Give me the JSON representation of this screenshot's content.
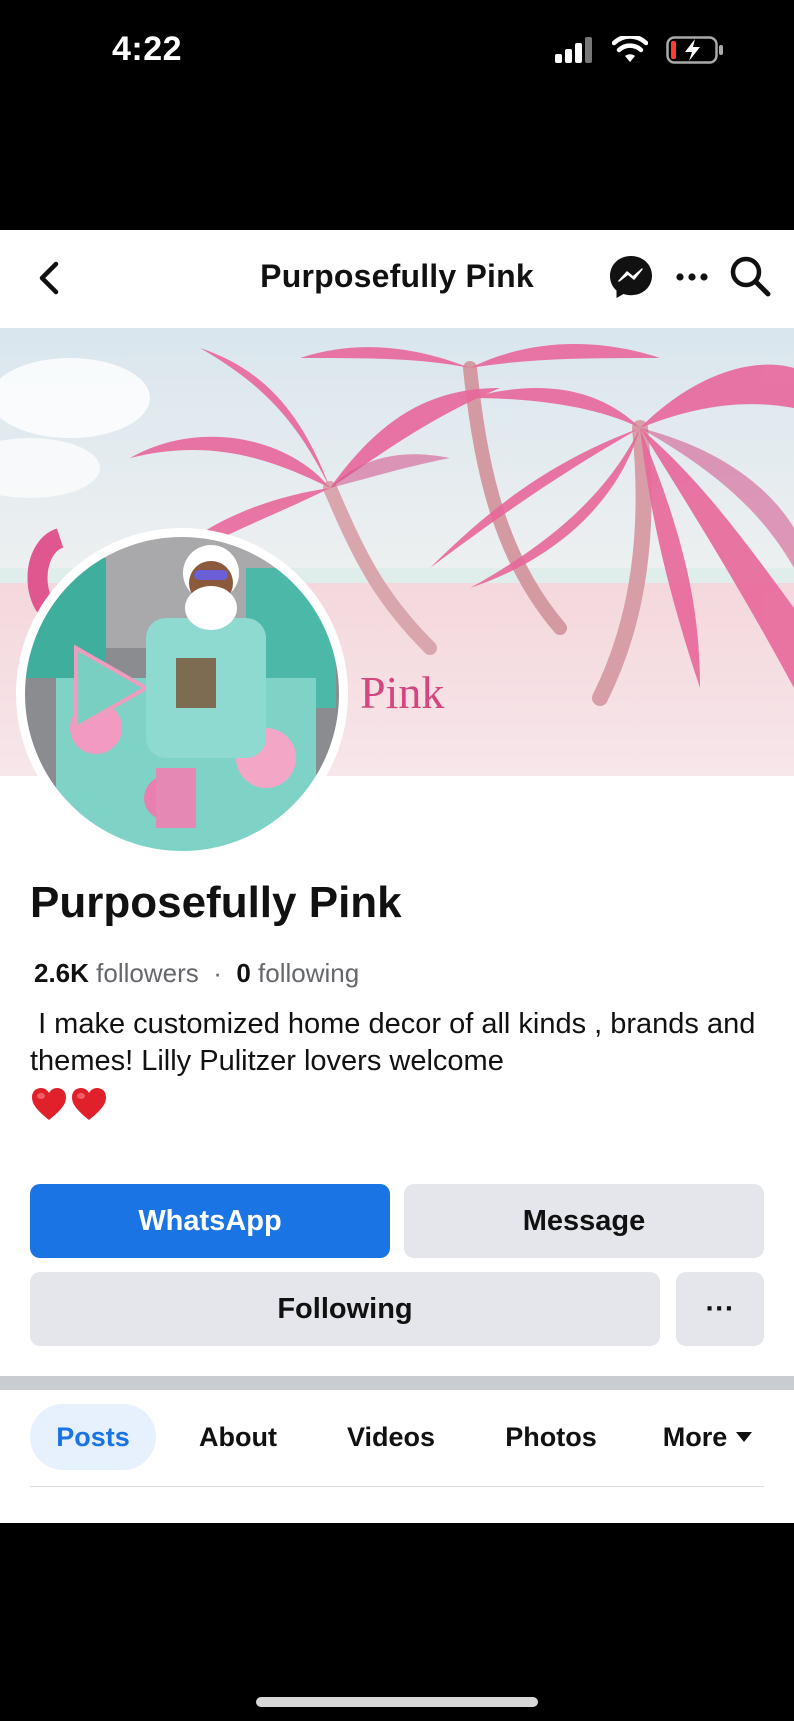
{
  "status_bar": {
    "time": "4:22"
  },
  "nav": {
    "title": "Purposefully Pink"
  },
  "cover": {
    "overlay_text": "Pink"
  },
  "profile": {
    "name": "Purposefully Pink",
    "followers_count": "2.6K",
    "followers_label": "followers",
    "separator": "·",
    "following_count": "0",
    "following_label": "following",
    "bio": "I make customized home  decor of all kinds , brands and themes!  Lilly Pulitzer lovers welcome",
    "bio_emoji": [
      "heart",
      "heart"
    ]
  },
  "actions": {
    "whatsapp": "WhatsApp",
    "message": "Message",
    "following": "Following",
    "more": "···"
  },
  "tabs": [
    {
      "label": "Posts",
      "active": true
    },
    {
      "label": "About"
    },
    {
      "label": "Videos"
    },
    {
      "label": "Photos"
    },
    {
      "label": "More"
    }
  ],
  "colors": {
    "accent": "#1b74e4",
    "active_tab_bg": "#e7f0fd",
    "button_gray": "#e4e6eb",
    "cover_pink": "#e8679a"
  }
}
